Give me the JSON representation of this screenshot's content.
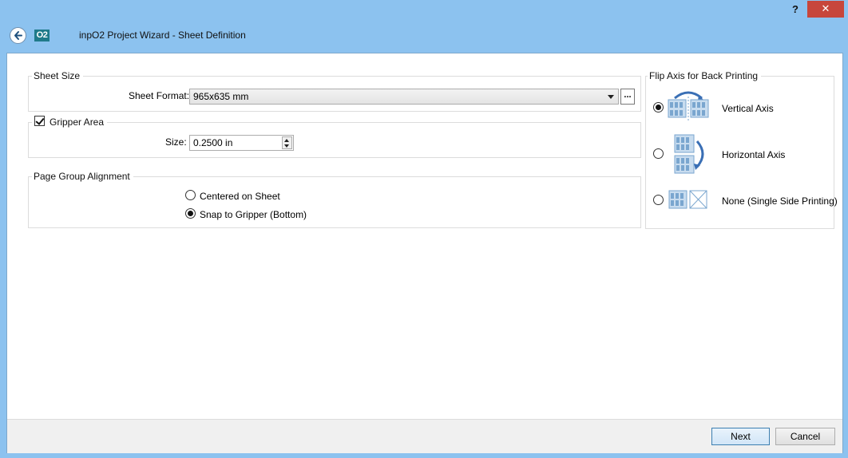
{
  "window": {
    "title": "inpO2 Project Wizard - Sheet Definition",
    "logo_text": "O2",
    "help_label": "?",
    "close_label": "✕",
    "back_icon": "back-arrow-icon"
  },
  "sheet_size": {
    "legend": "Sheet Size",
    "format_label": "Sheet Format:",
    "format_value": "965x635 mm",
    "browse_label": "..."
  },
  "gripper": {
    "legend": "Gripper Area",
    "checked": true,
    "size_label": "Size:",
    "size_value": "0.2500 in"
  },
  "alignment": {
    "legend": "Page Group Alignment",
    "options": [
      {
        "label": "Centered on Sheet",
        "selected": false
      },
      {
        "label": "Snap to Gripper (Bottom)",
        "selected": true
      }
    ]
  },
  "flip_axis": {
    "legend": "Flip Axis for Back Printing",
    "options": [
      {
        "label": "Vertical Axis",
        "selected": true,
        "icon": "vertical-flip-icon"
      },
      {
        "label": "Horizontal Axis",
        "selected": false,
        "icon": "horizontal-flip-icon"
      },
      {
        "label": "None (Single Side Printing)",
        "selected": false,
        "icon": "single-side-icon"
      }
    ]
  },
  "footer": {
    "next_label": "Next",
    "cancel_label": "Cancel"
  },
  "colors": {
    "chrome": "#8cc2ef",
    "close_button": "#c7463c",
    "logo": "#1f7a8a",
    "sheet_icon": "#7aa6cf",
    "flip_arrow": "#3a6fb5"
  }
}
